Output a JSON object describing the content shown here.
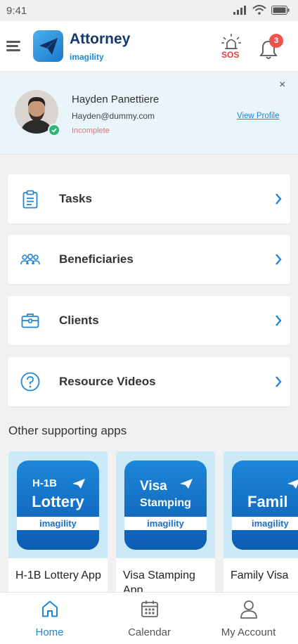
{
  "status_bar": {
    "time": "9:41"
  },
  "header": {
    "brand_name": "Attorney",
    "brand_sub": "imagility",
    "sos_label": "SOS",
    "notification_count": "3",
    "accent_color": "#1b8ad6"
  },
  "profile": {
    "name": "Hayden Panettiere",
    "email": "Hayden@dummy.com",
    "status": "Incomplete",
    "view_profile_label": "View Profile",
    "close_label": "×"
  },
  "menu": {
    "items": [
      {
        "label": "Tasks",
        "icon": "clipboard-icon"
      },
      {
        "label": "Beneficiaries",
        "icon": "people-group-icon"
      },
      {
        "label": "Clients",
        "icon": "briefcase-icon"
      },
      {
        "label": "Resource Videos",
        "icon": "question-circle-icon"
      }
    ]
  },
  "apps": {
    "section_title": "Other supporting apps",
    "items": [
      {
        "tile_line1": "H-1B",
        "tile_line2": "Lottery",
        "tile_brand": "imagility",
        "name": "H-1B Lottery App"
      },
      {
        "tile_line1": "Visa",
        "tile_line2": "Stamping",
        "tile_brand": "imagility",
        "name": "Visa Stamping App"
      },
      {
        "tile_line1": "",
        "tile_line2": "Famil",
        "tile_brand": "imagility",
        "name": "Family Visa"
      }
    ]
  },
  "bottom_nav": {
    "items": [
      {
        "label": "Home",
        "icon": "home-icon"
      },
      {
        "label": "Calendar",
        "icon": "calendar-icon"
      },
      {
        "label": "My Account",
        "icon": "user-icon"
      }
    ]
  }
}
